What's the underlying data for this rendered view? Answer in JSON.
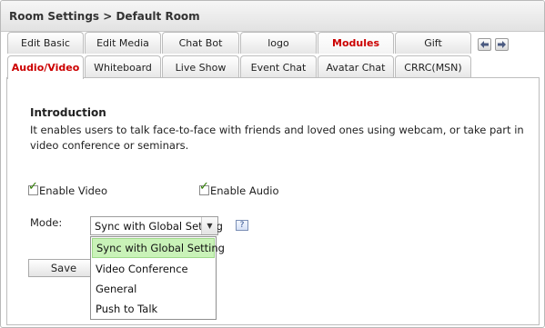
{
  "title": "Room Settings   > Default Room",
  "tabs_row1": [
    {
      "label": "Edit Basic",
      "active": false
    },
    {
      "label": "Edit Media",
      "active": false
    },
    {
      "label": "Chat Bot",
      "active": false
    },
    {
      "label": "logo",
      "active": false
    },
    {
      "label": "Modules",
      "active": true
    },
    {
      "label": "Gift",
      "active": false
    }
  ],
  "tabs_row2": [
    {
      "label": "Audio/Video",
      "active": true
    },
    {
      "label": "Whiteboard",
      "active": false
    },
    {
      "label": "Live Show",
      "active": false
    },
    {
      "label": "Event Chat",
      "active": false
    },
    {
      "label": "Avatar Chat",
      "active": false
    },
    {
      "label": "CRRC(MSN)",
      "active": false
    }
  ],
  "nav": {
    "prev_icon": "left-arrow-icon",
    "next_icon": "right-arrow-icon"
  },
  "intro": {
    "heading": "Introduction",
    "text": "It enables users to talk face-to-face with friends and loved ones using webcam, or take part in video conference or seminars."
  },
  "options": {
    "enable_video": {
      "label": "Enable Video",
      "checked": true
    },
    "enable_audio": {
      "label": "Enable Audio",
      "checked": true
    }
  },
  "mode": {
    "label": "Mode:",
    "selected": "Sync with Global Setting",
    "help_icon": "question-icon",
    "help_text": "?",
    "options": [
      "Sync with Global Setting",
      "Video Conference",
      "General",
      "Push to Talk"
    ]
  },
  "save_label": "Save",
  "colors": {
    "active_tab_text": "#cc0000",
    "selected_option_bg": "#c9f2b8",
    "check_color": "#2e7d00"
  }
}
